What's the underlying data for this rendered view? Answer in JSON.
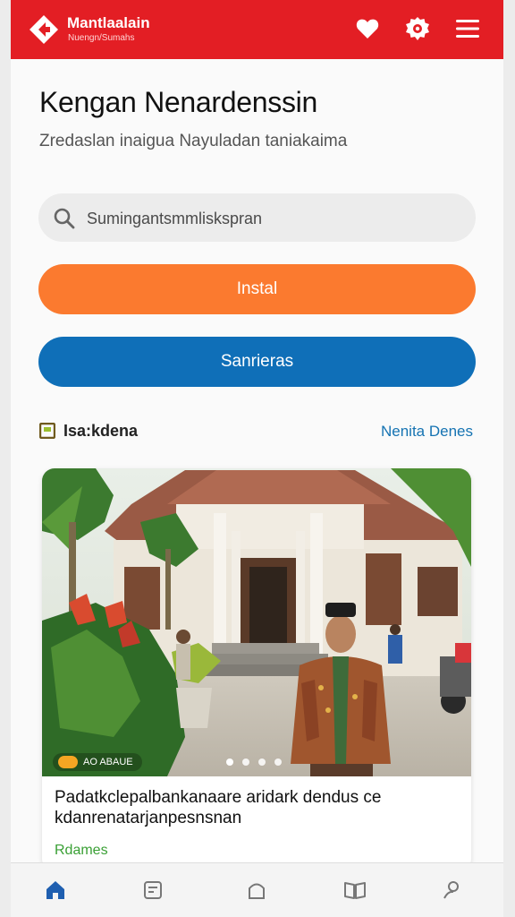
{
  "header": {
    "brand_name": "Mantlaalain",
    "brand_tagline": "Nuengn/Sumahs",
    "icons": [
      "heart-icon",
      "settings-icon",
      "menu-icon"
    ],
    "color": "#e31e24"
  },
  "hero": {
    "title": "Kengan Nenardenssin",
    "subtitle": "Zredaslan inaigua Nayuladan taniakaima"
  },
  "search": {
    "placeholder": "Sumingantsmmliskspran"
  },
  "buttons": {
    "install_label": "Instal",
    "services_label": "Sanrieras",
    "install_color": "#fb7a2f",
    "services_color": "#0f6fb8"
  },
  "section": {
    "title": "Isa:kdena",
    "link": "Nenita Denes"
  },
  "card": {
    "image_badge": "AO ABAUE",
    "dots": 4,
    "active_dot": 0,
    "title": "Padatkclepalbankanaare aridark dendus ce kdanrenatarjanpesnsnan",
    "meta": "Rdames"
  },
  "bottom_nav": {
    "items": [
      "home-icon",
      "news-icon",
      "bag-icon",
      "book-icon",
      "profile-icon"
    ],
    "active": "home-icon"
  }
}
